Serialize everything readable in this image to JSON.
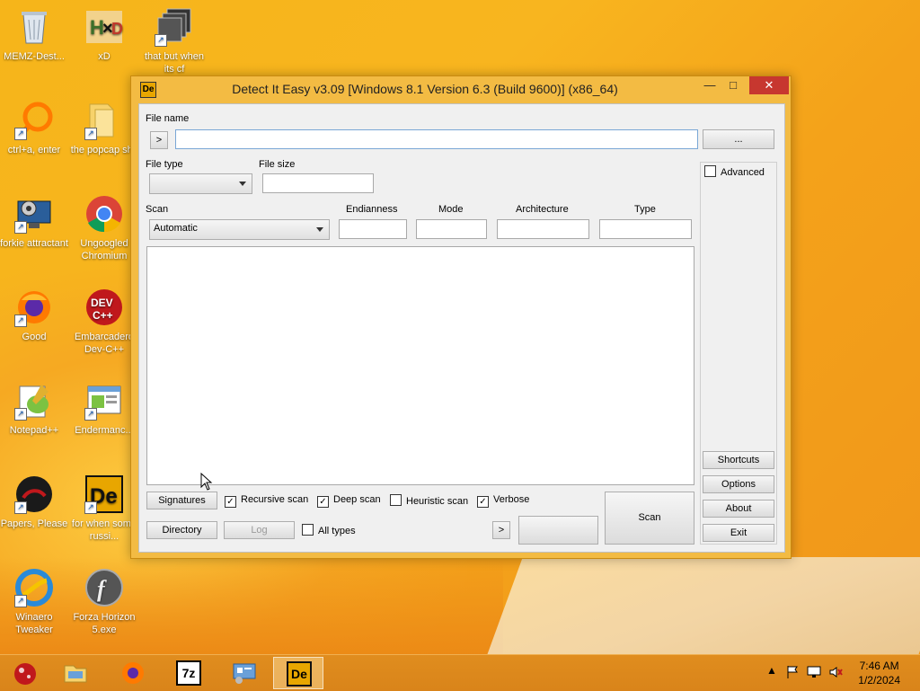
{
  "desktop": {
    "icons": [
      {
        "label": "MEMZ-Dest..."
      },
      {
        "label": "xD"
      },
      {
        "label": "that but when its cf"
      },
      {
        "label": "ctrl+a, enter"
      },
      {
        "label": "the popcap shit"
      },
      {
        "label": "forkie attractant"
      },
      {
        "label": "Ungoogled Chromium"
      },
      {
        "label": "Good"
      },
      {
        "label": "Embarcadero Dev-C++"
      },
      {
        "label": "Notepad++"
      },
      {
        "label": "Endermanc..."
      },
      {
        "label": "Papers, Please"
      },
      {
        "label": "for when some russi..."
      },
      {
        "label": "Winaero Tweaker"
      },
      {
        "label": "Forza Horizon 5.exe"
      }
    ]
  },
  "window": {
    "title": "Detect It Easy v3.09 [Windows 8.1 Version 6.3 (Build 9600)] (x86_64)",
    "icon_text": "De",
    "minimize_glyph": "—",
    "maximize_glyph": "□",
    "close_glyph": "✕",
    "file_name": {
      "label": "File name",
      "value": "",
      "go_button": ">",
      "browse_button": "..."
    },
    "file_type": {
      "label": "File type",
      "value": ""
    },
    "file_size": {
      "label": "File size",
      "value": ""
    },
    "scan": {
      "label": "Scan",
      "value": "Automatic"
    },
    "endianness": {
      "label": "Endianness",
      "value": ""
    },
    "mode": {
      "label": "Mode",
      "value": ""
    },
    "architecture": {
      "label": "Architecture",
      "value": ""
    },
    "type": {
      "label": "Type",
      "value": ""
    },
    "advanced": {
      "label": "Advanced",
      "checked": false
    },
    "side_buttons": {
      "shortcuts": "Shortcuts",
      "options": "Options",
      "about": "About",
      "exit": "Exit"
    },
    "bottom": {
      "signatures": "Signatures",
      "directory": "Directory",
      "log": "Log",
      "recursive_scan": {
        "label": "Recursive scan",
        "checked": true
      },
      "deep_scan": {
        "label": "Deep scan",
        "checked": true
      },
      "heuristic_scan": {
        "label": "Heuristic scan",
        "checked": false
      },
      "verbose": {
        "label": "Verbose",
        "checked": true
      },
      "all_types": {
        "label": "All types",
        "checked": false
      },
      "arrow_button": ">",
      "scan_button": "Scan"
    }
  },
  "taskbar": {
    "items": [
      "start",
      "file-explorer",
      "firefox",
      "7-zip",
      "control-panel",
      "detect-it-easy"
    ],
    "sevenzip_text": "7z",
    "die_text": "De",
    "clock_time": "7:46 AM",
    "clock_date": "1/2/2024"
  }
}
